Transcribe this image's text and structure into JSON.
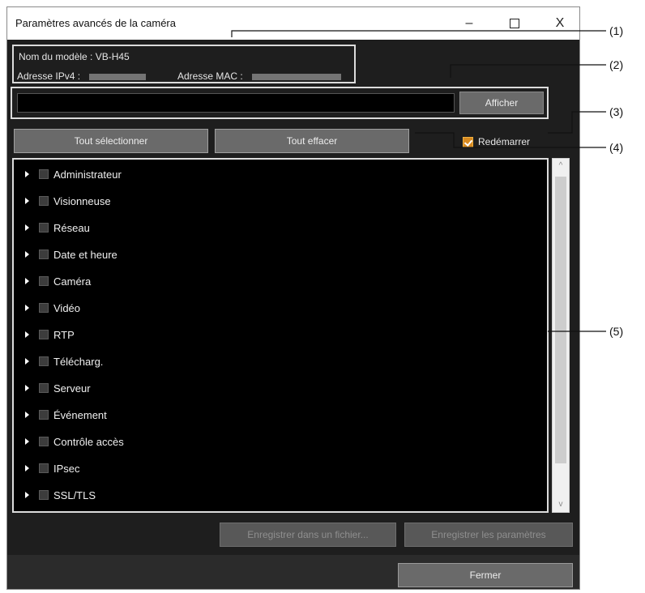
{
  "window": {
    "title": "Paramètres avancés de la caméra",
    "minimize_glyph": "–",
    "close_glyph": "X"
  },
  "info": {
    "model_line": "Nom du modèle :  VB-H45",
    "ipv4_label": "Adresse IPv4 :",
    "mac_label": "Adresse MAC :"
  },
  "address_bar": {
    "value": "",
    "placeholder": "",
    "show_button": "Afficher"
  },
  "toolbar": {
    "select_all": "Tout sélectionner",
    "clear_all": "Tout effacer",
    "restart_label": "Redémarrer",
    "restart_checked": true
  },
  "tree": {
    "items": [
      "Administrateur",
      "Visionneuse",
      "Réseau",
      "Date et heure",
      "Caméra",
      "Vidéo",
      "RTP",
      "Télécharg.",
      "Serveur",
      "Événement",
      "Contrôle accès",
      "IPsec",
      "SSL/TLS"
    ]
  },
  "scrollbar": {
    "up_glyph": "^",
    "down_glyph": "v"
  },
  "footer": {
    "save_to_file": "Enregistrer dans un fichier...",
    "save_settings": "Enregistrer les paramètres",
    "close": "Fermer"
  },
  "callouts": [
    "(1)",
    "(2)",
    "(3)",
    "(4)",
    "(5)"
  ],
  "colors": {
    "window_bg": "#1e1e1e",
    "tree_bg": "#000000",
    "button_bg": "#6a6a6a",
    "restart_check": "#d78a21"
  }
}
